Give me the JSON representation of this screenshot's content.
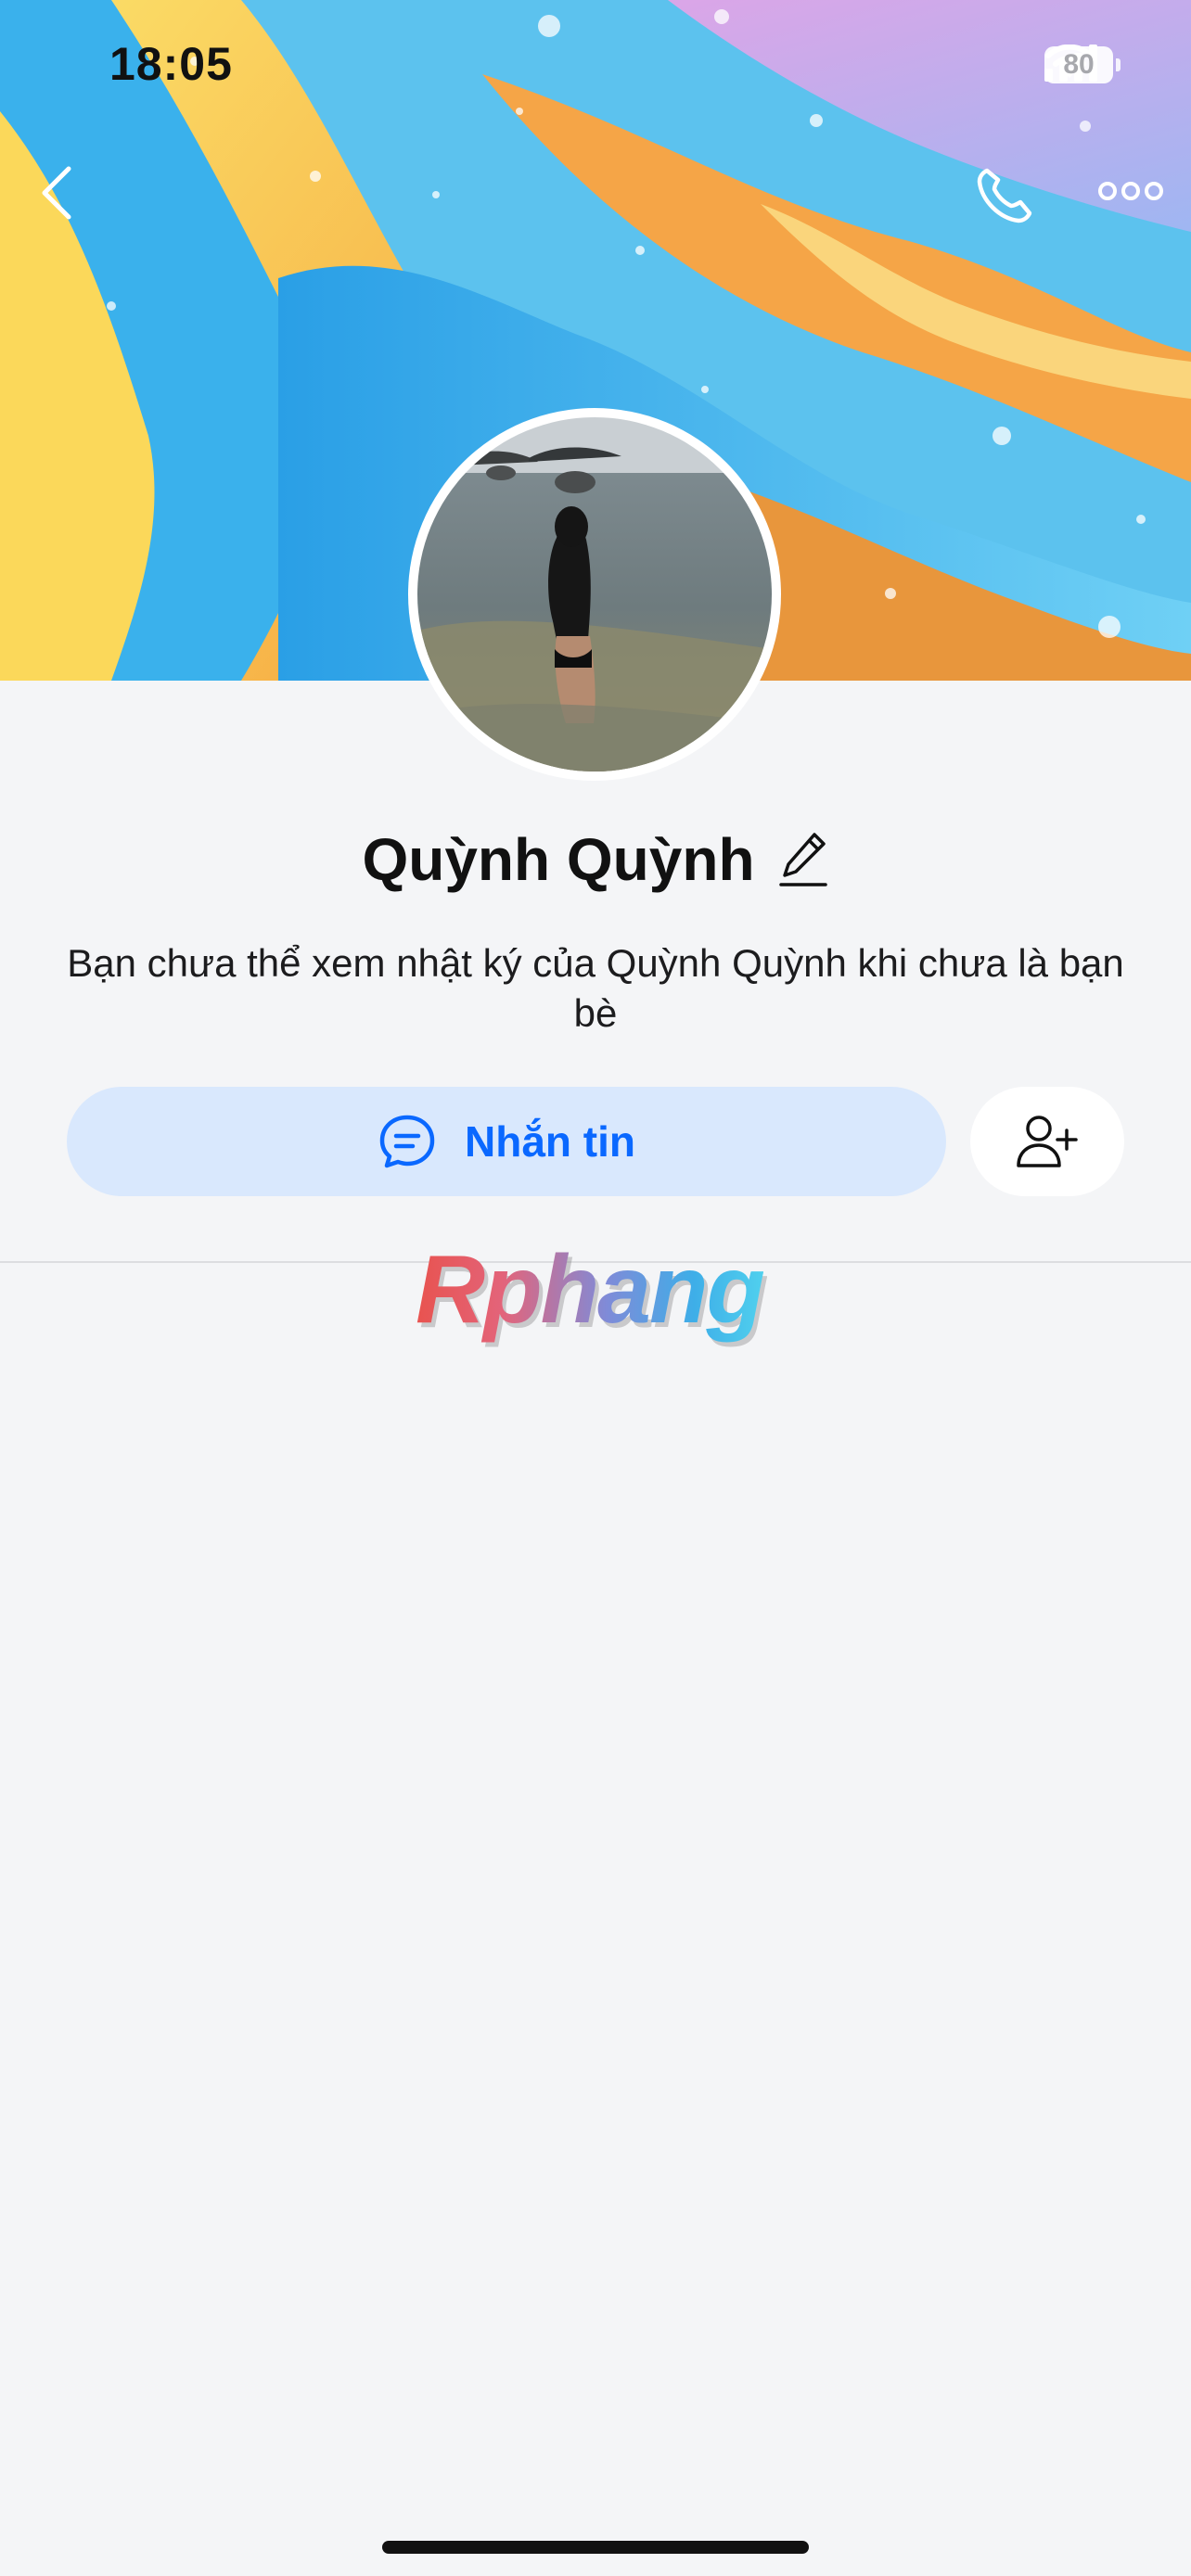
{
  "status_bar": {
    "time": "18:05",
    "battery": "80"
  },
  "profile": {
    "name": "Quỳnh Quỳnh",
    "privacy_note": "Bạn chưa thể xem nhật ký của Quỳnh Quỳnh khi chưa là bạn bè"
  },
  "actions": {
    "message_label": "Nhắn tin"
  },
  "watermark": {
    "text": "Rphang"
  },
  "icons": {
    "back": "chevron-left-icon",
    "call": "phone-icon",
    "more": "more-dots-icon",
    "edit": "pencil-icon",
    "message": "chat-bubble-icon",
    "add_friend": "add-user-icon"
  },
  "colors": {
    "accent": "#0a68ff",
    "message_button_bg": "#d9e8fd",
    "page_bg": "#f4f5f7"
  }
}
